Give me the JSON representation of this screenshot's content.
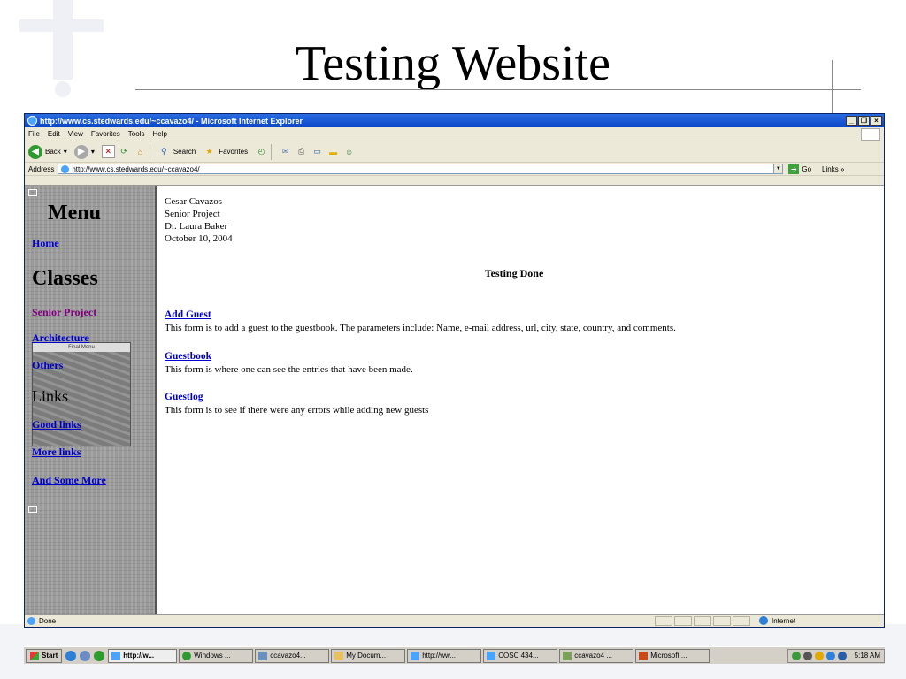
{
  "slide": {
    "title": "Testing Website"
  },
  "window": {
    "title": "http://www.cs.stedwards.edu/~ccavazo4/ - Microsoft Internet Explorer",
    "buttons": [
      "_",
      "×"
    ]
  },
  "menubar": [
    "File",
    "Edit",
    "View",
    "Favorites",
    "Tools",
    "Help"
  ],
  "toolbar": {
    "back": "Back",
    "search": "Search",
    "favorites": "Favorites"
  },
  "addressbar": {
    "label": "Address",
    "url": "http://www.cs.stedwards.edu/~ccavazo4/",
    "go": "Go",
    "links": "Links »"
  },
  "leftnav": {
    "menu_heading": "Menu",
    "home": "Home",
    "classes_heading": "Classes",
    "senior_project": "Senior Project",
    "architecture": "Architecture",
    "others": "Others",
    "links_heading": "Links",
    "good_links": "Good links",
    "more_links": "More links",
    "and_some_more": "And Some More",
    "image_header": "Final Menu"
  },
  "main": {
    "author": "Cesar Cavazos",
    "project": "Senior Project",
    "advisor": "Dr. Laura Baker",
    "date": "October 10, 2004",
    "heading": "Testing Done",
    "items": [
      {
        "link": "Add Guest",
        "desc": "This form is to add a guest to the guestbook. The parameters include: Name, e-mail address, url, city, state, country, and comments."
      },
      {
        "link": "Guestbook",
        "desc": "This form is where one can see the entries that have been made."
      },
      {
        "link": "Guestlog",
        "desc": "This form is to see if there were any errors while adding new guests"
      }
    ]
  },
  "statusbar": {
    "status": "Done",
    "zone": "Internet"
  },
  "taskbar": {
    "start": "Start",
    "tasks": [
      "http://w...",
      "Windows ...",
      "ccavazo4...",
      "My Docum...",
      "http://ww...",
      "COSC 434...",
      "ccavazo4 ...",
      "Microsoft ..."
    ],
    "clock": "5:18 AM"
  }
}
